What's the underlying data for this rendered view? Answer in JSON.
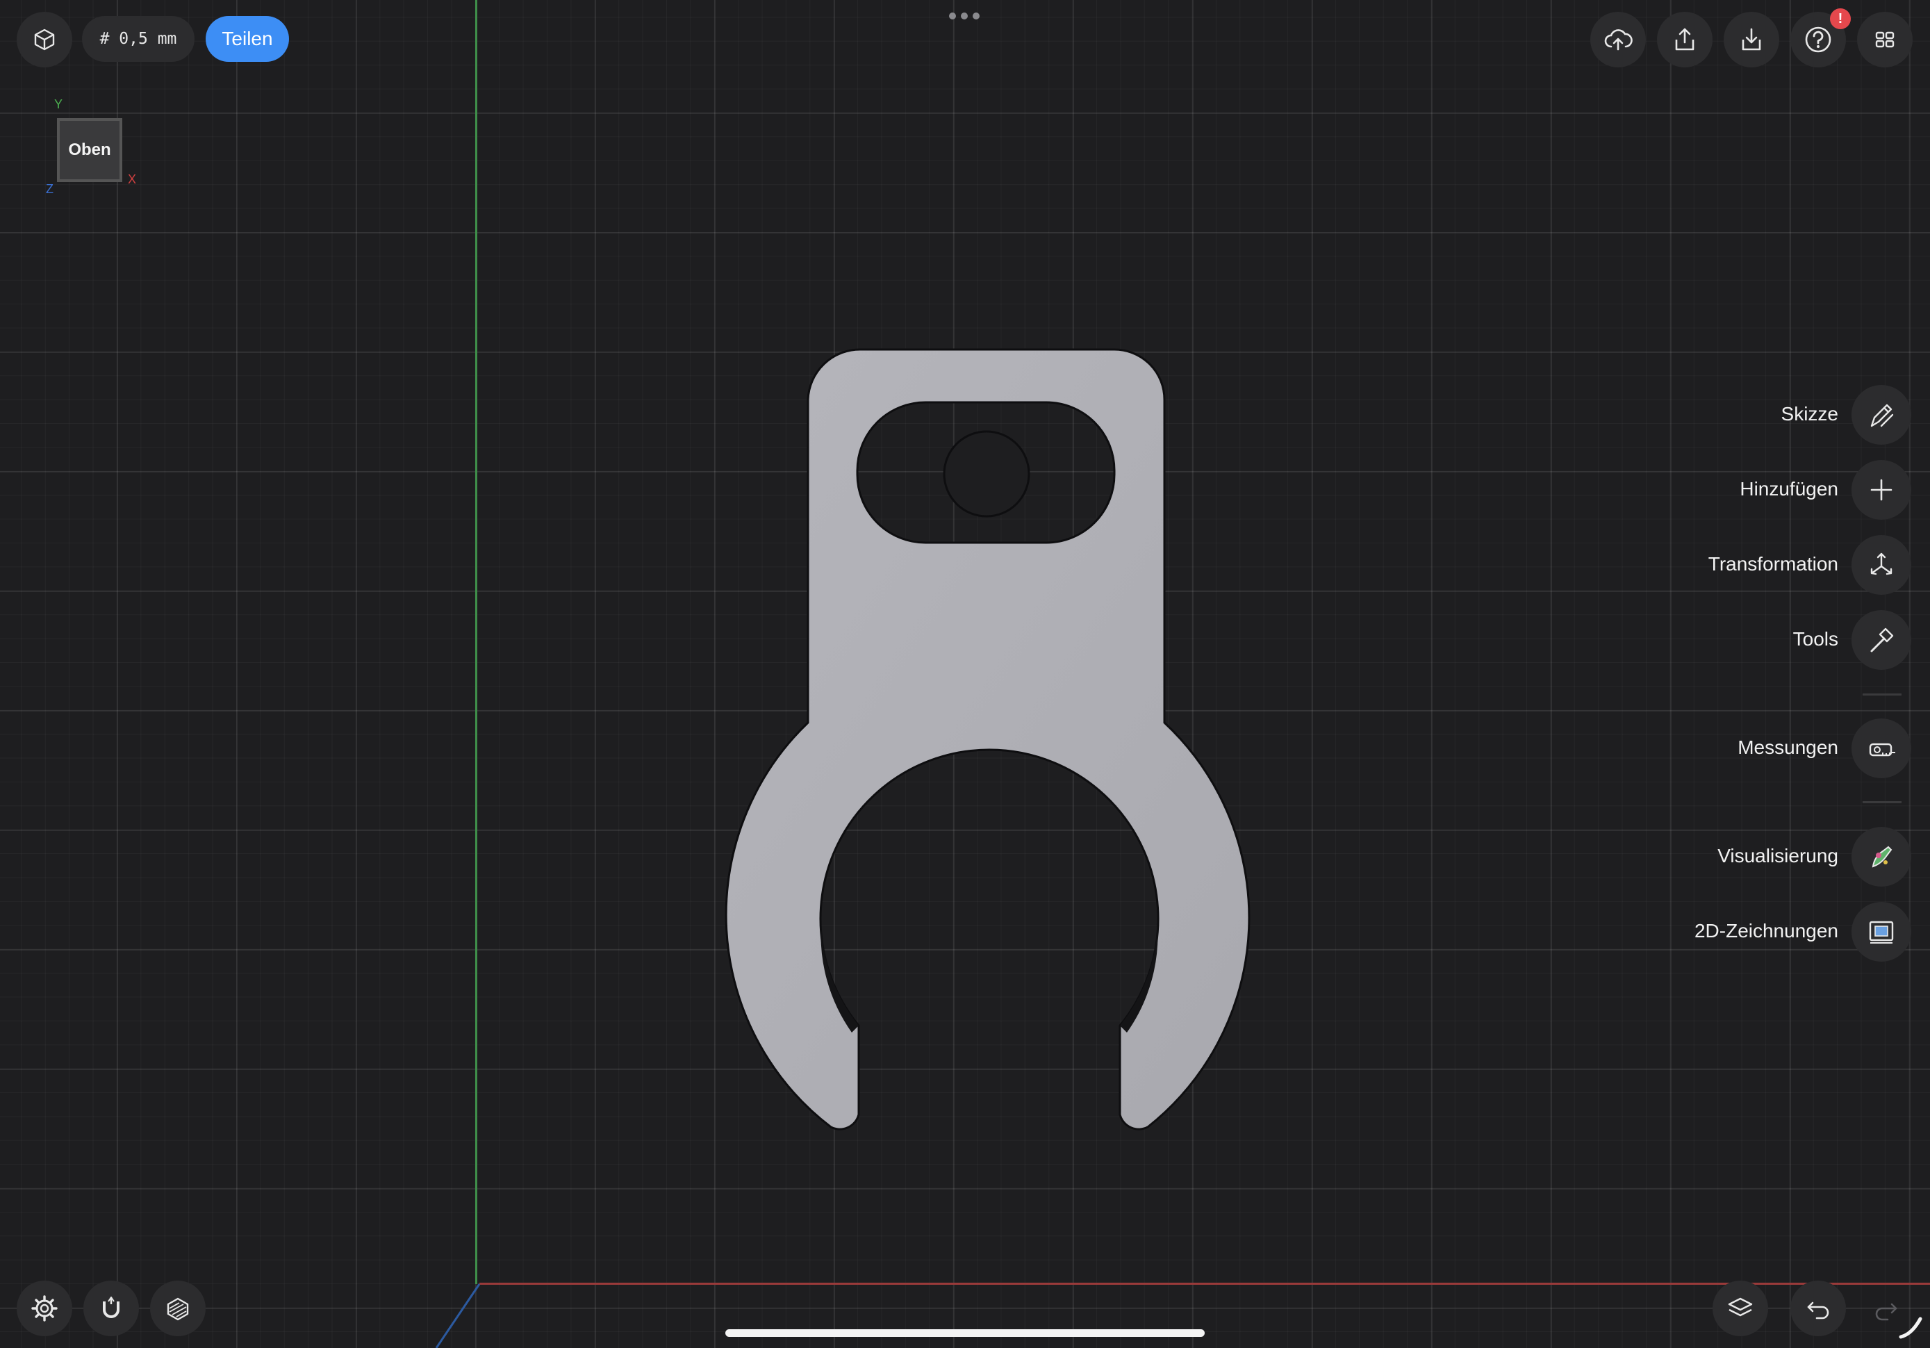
{
  "toolbar": {
    "grid_size": "# 0,5 mm",
    "share_label": "Teilen",
    "notification_badge": "!",
    "accent_color": "#3d8ef5"
  },
  "viewcube": {
    "face_label": "Oben",
    "axis_y": "Y",
    "axis_x": "X",
    "axis_z": "Z"
  },
  "side_menu": {
    "items": [
      {
        "label": "Skizze",
        "icon": "pencil-ruler-icon"
      },
      {
        "label": "Hinzufügen",
        "icon": "plus-icon"
      },
      {
        "label": "Transformation",
        "icon": "transform-arrows-icon"
      },
      {
        "label": "Tools",
        "icon": "hammer-icon"
      },
      {
        "label": "Messungen",
        "icon": "tape-measure-icon"
      },
      {
        "label": "Visualisierung",
        "icon": "render-icon"
      },
      {
        "label": "2D-Zeichnungen",
        "icon": "drawing-sheet-icon"
      }
    ]
  },
  "bottom_left": [
    "settings-icon",
    "magnet-icon",
    "section-view-icon"
  ],
  "bottom_right": [
    "layers-icon",
    "undo-icon",
    "redo-icon"
  ],
  "axis_colors": {
    "x": "#9a3a3a",
    "y": "#3f8f4a",
    "z": "#2c5aa0"
  }
}
